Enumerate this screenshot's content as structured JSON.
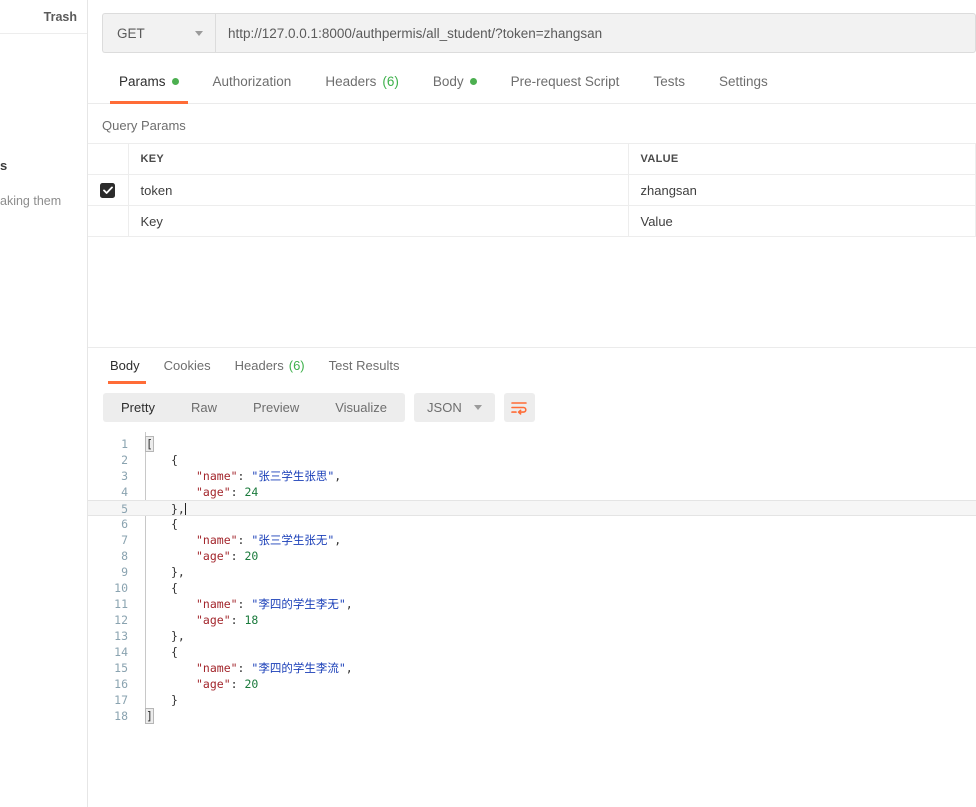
{
  "sidebar": {
    "trash_label": "Trash",
    "fragment_title": "s",
    "fragment_text": "aking them"
  },
  "request": {
    "method": "GET",
    "url": "http://127.0.0.1:8000/authpermis/all_student/?token=zhangsan",
    "tabs": [
      {
        "label": "Params",
        "indicator": "dot",
        "active": true
      },
      {
        "label": "Authorization",
        "indicator": "",
        "active": false
      },
      {
        "label": "Headers",
        "indicator": "(6)",
        "active": false
      },
      {
        "label": "Body",
        "indicator": "dot",
        "active": false
      },
      {
        "label": "Pre-request Script",
        "indicator": "",
        "active": false
      },
      {
        "label": "Tests",
        "indicator": "",
        "active": false
      },
      {
        "label": "Settings",
        "indicator": "",
        "active": false
      }
    ],
    "query_params": {
      "section_title": "Query Params",
      "columns": [
        "KEY",
        "VALUE"
      ],
      "rows": [
        {
          "checked": true,
          "key": "token",
          "value": "zhangsan"
        }
      ],
      "placeholder_row": {
        "key": "Key",
        "value": "Value"
      }
    }
  },
  "response": {
    "tabs": [
      {
        "label": "Body",
        "indicator": "",
        "active": true
      },
      {
        "label": "Cookies",
        "indicator": "",
        "active": false
      },
      {
        "label": "Headers",
        "indicator": "(6)",
        "active": false
      },
      {
        "label": "Test Results",
        "indicator": "",
        "active": false
      }
    ],
    "view_modes": [
      {
        "label": "Pretty",
        "active": true
      },
      {
        "label": "Raw",
        "active": false
      },
      {
        "label": "Preview",
        "active": false
      },
      {
        "label": "Visualize",
        "active": false
      }
    ],
    "format": "JSON",
    "wrap_icon": "wrap-lines-icon",
    "body_lines": [
      {
        "n": "1",
        "indent": 0,
        "tokens": [
          {
            "t": "[",
            "c": "k-pun brk"
          }
        ]
      },
      {
        "n": "2",
        "indent": 1,
        "tokens": [
          {
            "t": "{",
            "c": "k-pun"
          }
        ]
      },
      {
        "n": "3",
        "indent": 2,
        "tokens": [
          {
            "t": "\"name\"",
            "c": "k-key"
          },
          {
            "t": ": ",
            "c": "k-pun"
          },
          {
            "t": "\"张三学生张思\"",
            "c": "k-str"
          },
          {
            "t": ",",
            "c": "k-pun"
          }
        ]
      },
      {
        "n": "4",
        "indent": 2,
        "tokens": [
          {
            "t": "\"age\"",
            "c": "k-key"
          },
          {
            "t": ": ",
            "c": "k-pun"
          },
          {
            "t": "24",
            "c": "k-num"
          }
        ]
      },
      {
        "n": "5",
        "indent": 1,
        "highlight": true,
        "cursor": true,
        "tokens": [
          {
            "t": "},",
            "c": "k-pun"
          }
        ]
      },
      {
        "n": "6",
        "indent": 1,
        "tokens": [
          {
            "t": "{",
            "c": "k-pun"
          }
        ]
      },
      {
        "n": "7",
        "indent": 2,
        "tokens": [
          {
            "t": "\"name\"",
            "c": "k-key"
          },
          {
            "t": ": ",
            "c": "k-pun"
          },
          {
            "t": "\"张三学生张无\"",
            "c": "k-str"
          },
          {
            "t": ",",
            "c": "k-pun"
          }
        ]
      },
      {
        "n": "8",
        "indent": 2,
        "tokens": [
          {
            "t": "\"age\"",
            "c": "k-key"
          },
          {
            "t": ": ",
            "c": "k-pun"
          },
          {
            "t": "20",
            "c": "k-num"
          }
        ]
      },
      {
        "n": "9",
        "indent": 1,
        "tokens": [
          {
            "t": "},",
            "c": "k-pun"
          }
        ]
      },
      {
        "n": "10",
        "indent": 1,
        "tokens": [
          {
            "t": "{",
            "c": "k-pun"
          }
        ]
      },
      {
        "n": "11",
        "indent": 2,
        "tokens": [
          {
            "t": "\"name\"",
            "c": "k-key"
          },
          {
            "t": ": ",
            "c": "k-pun"
          },
          {
            "t": "\"李四的学生李无\"",
            "c": "k-str"
          },
          {
            "t": ",",
            "c": "k-pun"
          }
        ]
      },
      {
        "n": "12",
        "indent": 2,
        "tokens": [
          {
            "t": "\"age\"",
            "c": "k-key"
          },
          {
            "t": ": ",
            "c": "k-pun"
          },
          {
            "t": "18",
            "c": "k-num"
          }
        ]
      },
      {
        "n": "13",
        "indent": 1,
        "tokens": [
          {
            "t": "},",
            "c": "k-pun"
          }
        ]
      },
      {
        "n": "14",
        "indent": 1,
        "tokens": [
          {
            "t": "{",
            "c": "k-pun"
          }
        ]
      },
      {
        "n": "15",
        "indent": 2,
        "tokens": [
          {
            "t": "\"name\"",
            "c": "k-key"
          },
          {
            "t": ": ",
            "c": "k-pun"
          },
          {
            "t": "\"李四的学生李流\"",
            "c": "k-str"
          },
          {
            "t": ",",
            "c": "k-pun"
          }
        ]
      },
      {
        "n": "16",
        "indent": 2,
        "tokens": [
          {
            "t": "\"age\"",
            "c": "k-key"
          },
          {
            "t": ": ",
            "c": "k-pun"
          },
          {
            "t": "20",
            "c": "k-num"
          }
        ]
      },
      {
        "n": "17",
        "indent": 1,
        "tokens": [
          {
            "t": "}",
            "c": "k-pun"
          }
        ]
      },
      {
        "n": "18",
        "indent": 0,
        "tokens": [
          {
            "t": "]",
            "c": "k-pun brk"
          }
        ]
      }
    ]
  },
  "colors": {
    "accent": "#ff6c37",
    "green": "#4caf50",
    "count_green": "#3db14b",
    "json_key": "#a3262c",
    "json_string": "#1a3fb8",
    "json_number": "#1a7a3c",
    "gutter": "#8aa3b0"
  }
}
